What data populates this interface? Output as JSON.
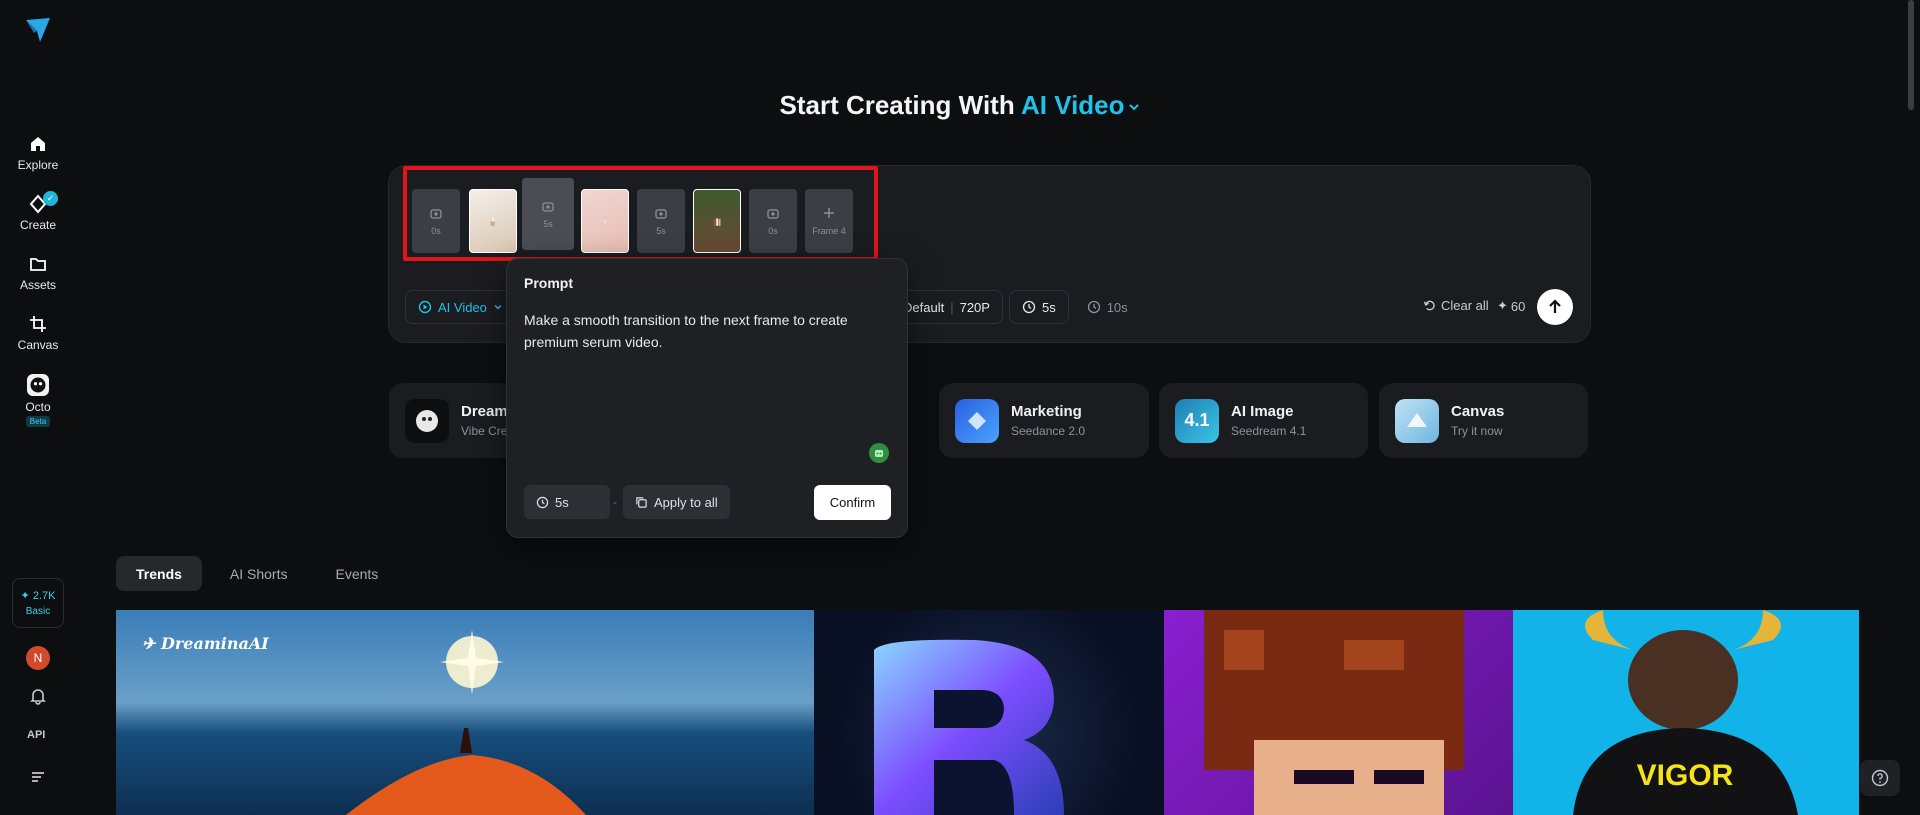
{
  "heading": {
    "prefix": "Start Creating With",
    "accent": "AI Video"
  },
  "sidebar": {
    "items": [
      {
        "label": "Explore"
      },
      {
        "label": "Create"
      },
      {
        "label": "Assets"
      },
      {
        "label": "Canvas"
      },
      {
        "label": "Octo",
        "badge": "Beta"
      }
    ],
    "credits": {
      "amount": "2.7K",
      "plan": "Basic"
    },
    "avatar_initial": "N",
    "api_label": "API"
  },
  "frames": [
    {
      "type": "empty",
      "duration": "0s"
    },
    {
      "type": "image",
      "desc": "hand holding serum bottle"
    },
    {
      "type": "empty",
      "duration": "5s",
      "active": true
    },
    {
      "type": "image",
      "desc": "pink serum dropper"
    },
    {
      "type": "empty",
      "duration": "5s"
    },
    {
      "type": "image",
      "desc": "serum tubes outdoors"
    },
    {
      "type": "empty",
      "duration": "0s"
    },
    {
      "type": "add",
      "label": "Frame 4"
    }
  ],
  "controls": {
    "mode": "AI Video",
    "aspect": "Default",
    "resolution": "720P",
    "duration": "5s",
    "duration_alt": "10s",
    "clear_all": "Clear all",
    "cost": "60"
  },
  "popover": {
    "title": "Prompt",
    "text": "Make a smooth transition to the next frame to create premium serum video.",
    "duration": "5s",
    "apply_all": "Apply to all",
    "confirm": "Confirm"
  },
  "cards": [
    {
      "title": "Dreami",
      "subtitle": "Vibe Cre"
    },
    {
      "title": "Marketing",
      "subtitle": "Seedance 2.0"
    },
    {
      "title": "AI Image",
      "subtitle": "Seedream 4.1",
      "icon_text": "4.1"
    },
    {
      "title": "Canvas",
      "subtitle": "Try it now"
    }
  ],
  "tabs": [
    "Trends",
    "AI Shorts",
    "Events"
  ],
  "gallery": {
    "brand": "DreaminaAI",
    "vigor_text": "VIGOR"
  },
  "colors": {
    "accent": "#21c2e8",
    "highlight": "#e0151b",
    "bg": "#0d0e10"
  }
}
